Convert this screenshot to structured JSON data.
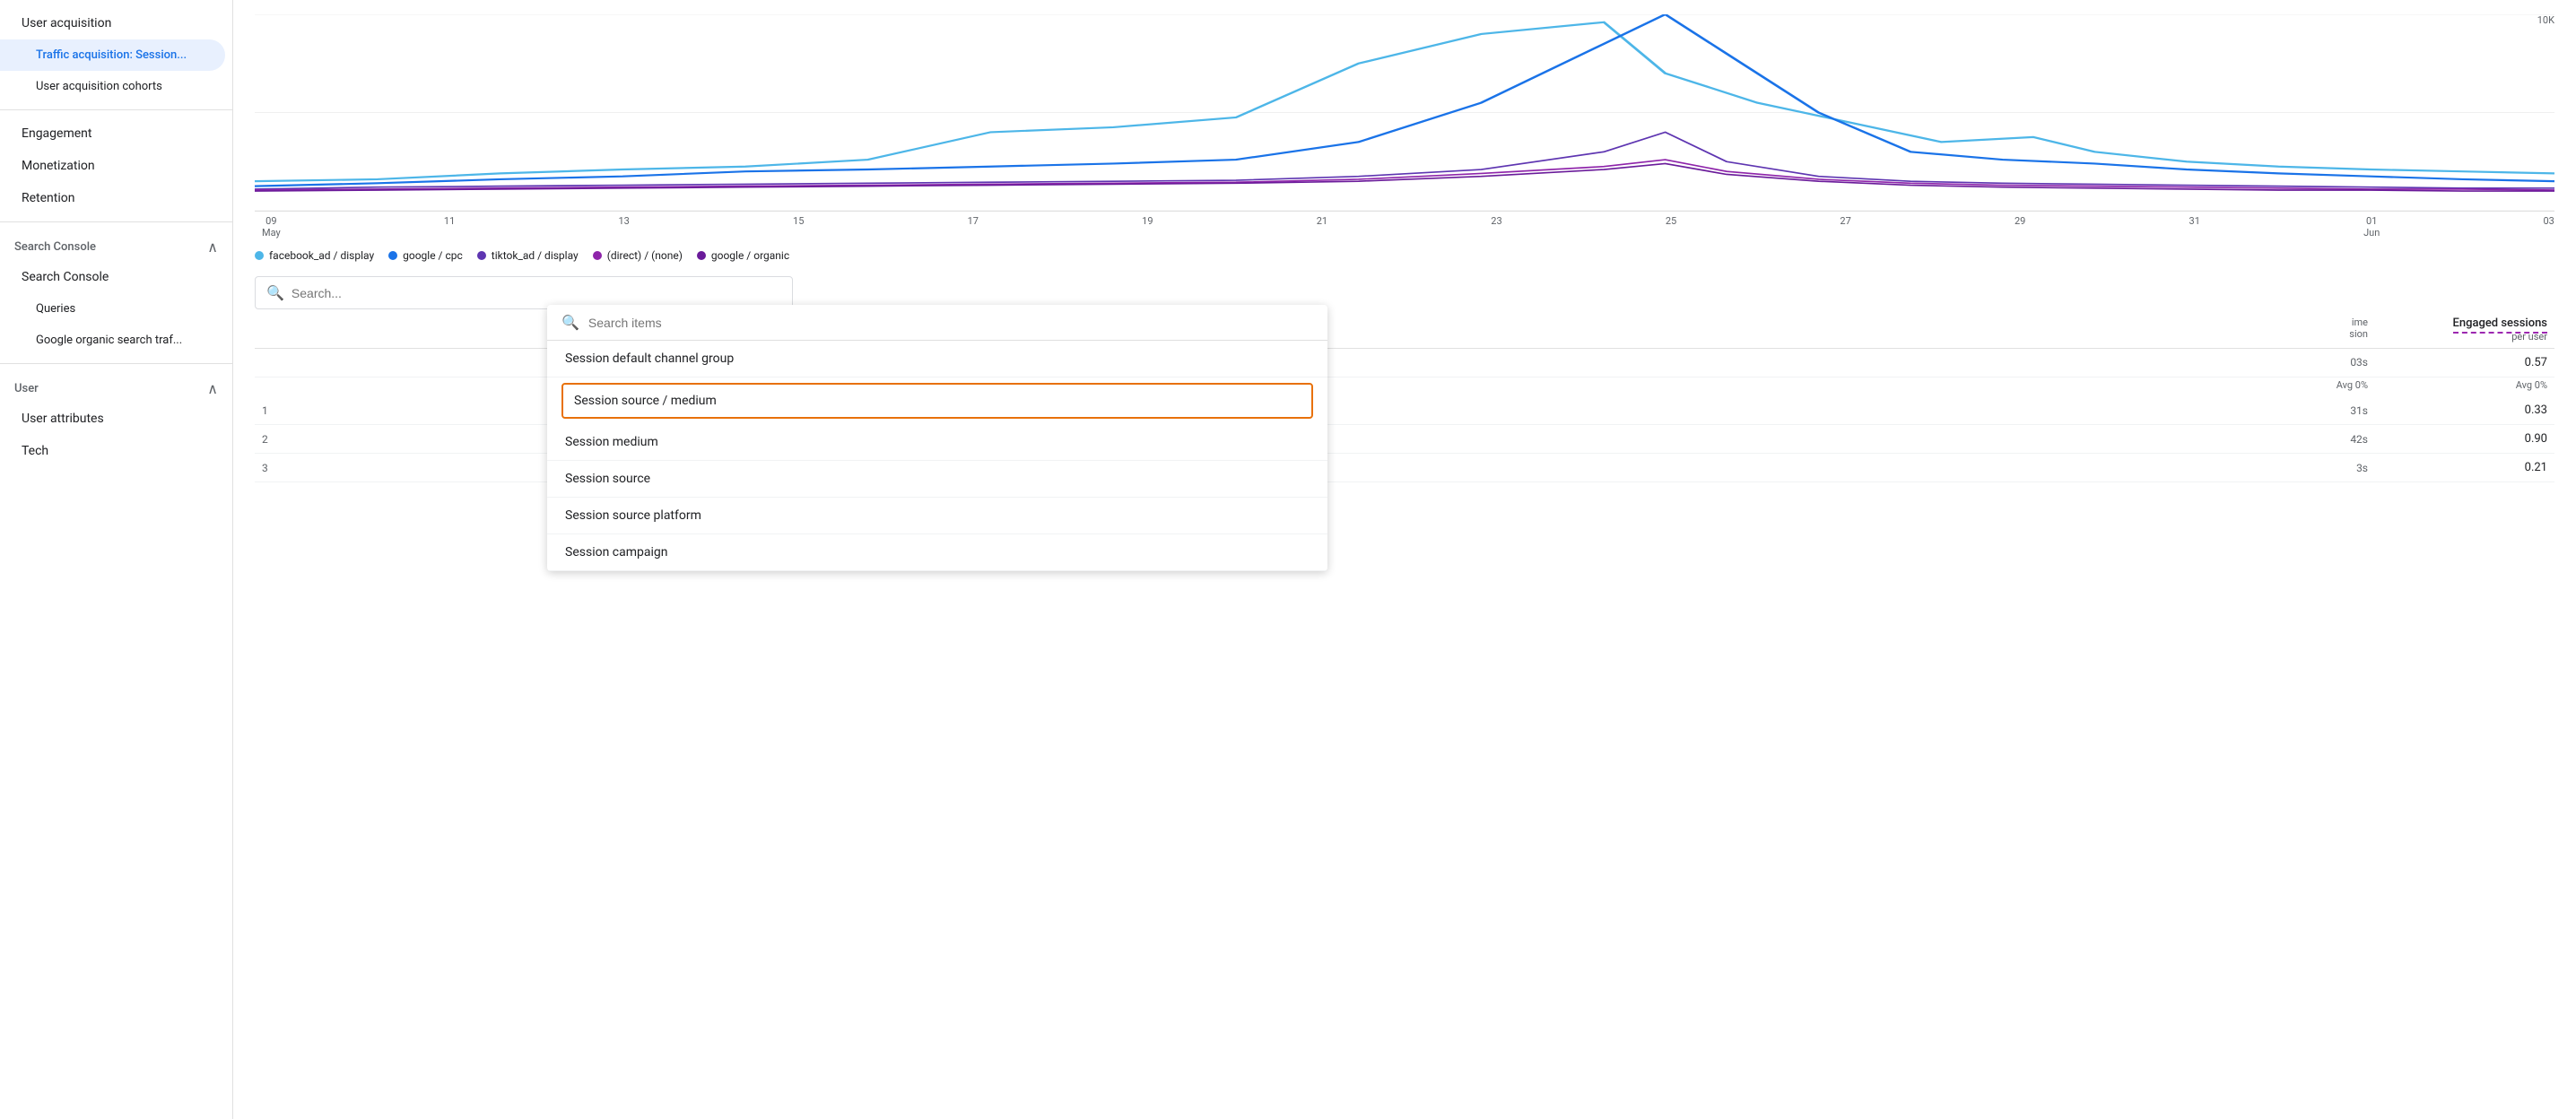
{
  "sidebar": {
    "items": [
      {
        "id": "user-acquisition",
        "label": "User acquisition",
        "level": 0,
        "active": false
      },
      {
        "id": "traffic-acquisition",
        "label": "Traffic acquisition: Session...",
        "level": 1,
        "active": true
      },
      {
        "id": "user-acquisition-cohorts",
        "label": "User acquisition cohorts",
        "level": 1,
        "active": false
      },
      {
        "id": "engagement",
        "label": "Engagement",
        "level": 0,
        "active": false
      },
      {
        "id": "monetization",
        "label": "Monetization",
        "level": 0,
        "active": false
      },
      {
        "id": "retention",
        "label": "Retention",
        "level": 0,
        "active": false
      }
    ],
    "sections": [
      {
        "id": "search-console",
        "label": "Search Console",
        "expanded": true,
        "children": [
          {
            "id": "search-console-main",
            "label": "Search Console"
          },
          {
            "id": "queries",
            "label": "Queries"
          },
          {
            "id": "google-organic",
            "label": "Google organic search traf..."
          }
        ]
      },
      {
        "id": "user-section",
        "label": "User",
        "expanded": true,
        "children": [
          {
            "id": "user-attributes",
            "label": "User attributes"
          },
          {
            "id": "tech",
            "label": "Tech"
          }
        ]
      }
    ]
  },
  "chart": {
    "y_max_label": "10K",
    "x_labels": [
      "09\nMay",
      "11",
      "13",
      "15",
      "17",
      "19",
      "21",
      "23",
      "25",
      "27",
      "29",
      "31",
      "01\nJun",
      "03"
    ],
    "legend": [
      {
        "id": "facebook",
        "label": "facebook_ad / display",
        "color": "#4db6e8"
      },
      {
        "id": "google-cpc",
        "label": "google / cpc",
        "color": "#1a73e8"
      },
      {
        "id": "tiktok",
        "label": "tiktok_ad / display",
        "color": "#5e35b1"
      },
      {
        "id": "direct",
        "label": "(direct) / (none)",
        "color": "#8e24aa"
      },
      {
        "id": "google-organic",
        "label": "google / organic",
        "color": "#6a1b9a"
      }
    ]
  },
  "search": {
    "placeholder": "Search...",
    "search_icon": "🔍"
  },
  "dropdown": {
    "search_placeholder": "Search items",
    "items": [
      {
        "id": "session-default",
        "label": "Session default channel group",
        "highlighted": false
      },
      {
        "id": "session-source-medium",
        "label": "Session source / medium",
        "highlighted": true
      },
      {
        "id": "session-medium",
        "label": "Session medium",
        "highlighted": false
      },
      {
        "id": "session-source",
        "label": "Session source",
        "highlighted": false
      },
      {
        "id": "session-source-platform",
        "label": "Session source platform",
        "highlighted": false
      },
      {
        "id": "session-campaign",
        "label": "Session campaign",
        "highlighted": false
      }
    ]
  },
  "table": {
    "col_time_label": "ime\nsion",
    "col_engaged_label": "Engaged sessions",
    "col_engaged_sub": "per user",
    "total_time": "03s",
    "total_engaged": "0.57",
    "avg_time": "Avg 0%",
    "avg_engaged": "Avg 0%",
    "rows": [
      {
        "num": "1",
        "time": "31s",
        "engaged": "0.33"
      },
      {
        "num": "2",
        "time": "42s",
        "engaged": "0.90"
      },
      {
        "num": "3",
        "time": "3s",
        "engaged": "0.21"
      }
    ]
  }
}
